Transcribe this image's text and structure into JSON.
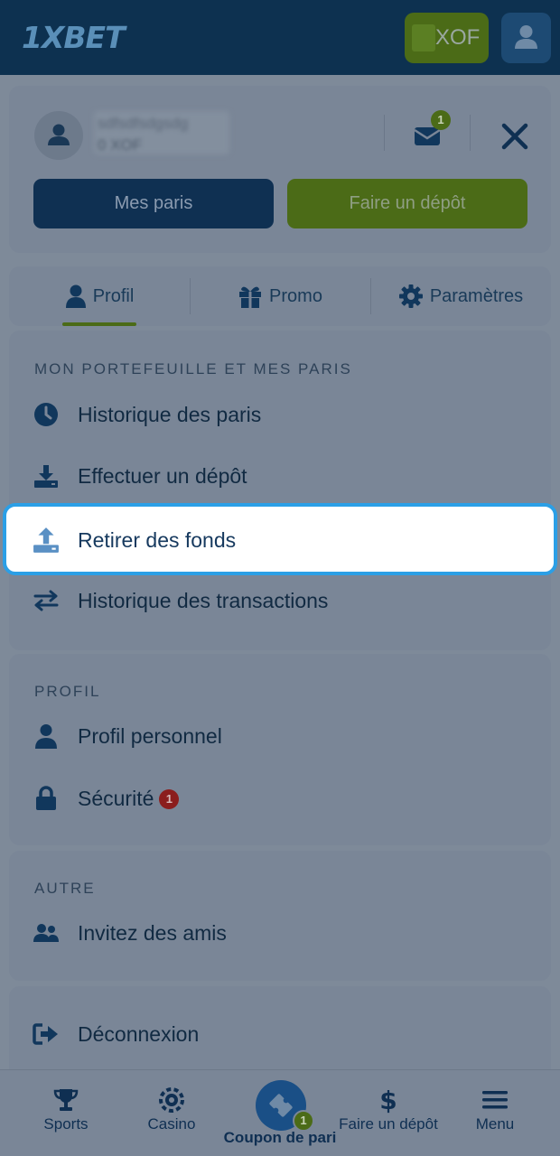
{
  "header": {
    "logo": "1XBET",
    "currency": "XOF"
  },
  "account": {
    "username_blurred": "sdfsdfsdgsdg",
    "balance_blurred": "0 XOF",
    "mail_badge": "1",
    "my_bets_label": "Mes paris",
    "deposit_label": "Faire un dépôt"
  },
  "tabs": [
    {
      "label": "Profil",
      "icon": "user-icon",
      "active": true
    },
    {
      "label": "Promo",
      "icon": "gift-icon"
    },
    {
      "label": "Paramètres",
      "icon": "gear-icon"
    }
  ],
  "sections": {
    "wallet": {
      "title": "MON PORTEFEUILLE ET MES PARIS",
      "items": [
        {
          "label": "Historique des paris",
          "icon": "clock-icon"
        },
        {
          "label": "Effectuer un dépôt",
          "icon": "download-icon"
        },
        {
          "label": "Retirer des fonds",
          "icon": "upload-icon",
          "highlighted": true
        },
        {
          "label": "Historique des transactions",
          "icon": "transfer-icon"
        }
      ]
    },
    "profile": {
      "title": "PROFIL",
      "items": [
        {
          "label": "Profil personnel",
          "icon": "person-icon"
        },
        {
          "label": "Sécurité",
          "icon": "lock-icon",
          "badge": "1"
        }
      ]
    },
    "other": {
      "title": "AUTRE",
      "items": [
        {
          "label": "Invitez des amis",
          "icon": "friends-icon"
        }
      ]
    },
    "logout": {
      "label": "Déconnexion",
      "icon": "logout-icon"
    }
  },
  "bottom_nav": {
    "items": [
      {
        "label": "Sports",
        "icon": "trophy-icon"
      },
      {
        "label": "Casino",
        "icon": "chip-icon"
      },
      {
        "label": "Coupon de pari",
        "icon": "ticket-icon",
        "badge": "1"
      },
      {
        "label": "Faire un dépôt",
        "icon": "dollar-icon"
      },
      {
        "label": "Menu",
        "icon": "hamburger-icon"
      }
    ]
  },
  "colors": {
    "header_bg": "#0d3150",
    "green": "#4b6b17",
    "highlight_border": "#2b9fe6",
    "badge_red": "#8b1d1d"
  }
}
